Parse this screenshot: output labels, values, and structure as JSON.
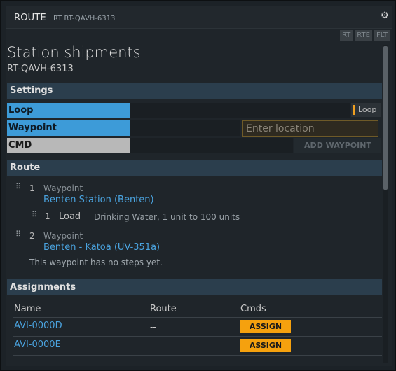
{
  "window": {
    "title": "ROUTE",
    "subtitle": "RT RT-QAVH-6313",
    "settings_icon": "gear-icon"
  },
  "modes": [
    "RT",
    "RTE",
    "FLT"
  ],
  "page": {
    "title": "Station shipments",
    "subtitle": "RT-QAVH-6313"
  },
  "settings": {
    "heading": "Settings",
    "loop_label": "Loop",
    "loop_toggle_text": "Loop",
    "waypoint_label": "Waypoint",
    "location_placeholder": "Enter location",
    "location_value": "",
    "cmd_label": "CMD",
    "add_waypoint_label": "ADD WAYPOINT"
  },
  "route": {
    "heading": "Route",
    "waypoints": [
      {
        "number": "1",
        "type": "Waypoint",
        "location": "Benten Station (Benten)",
        "steps": [
          {
            "number": "1",
            "action": "Load",
            "detail": "Drinking Water, 1 unit to 100 units"
          }
        ]
      },
      {
        "number": "2",
        "type": "Waypoint",
        "location": "Benten - Katoa (UV-351a)",
        "empty_text": "This waypoint has no steps yet."
      }
    ]
  },
  "assignments": {
    "heading": "Assignments",
    "columns": [
      "Name",
      "Route",
      "Cmds"
    ],
    "rows": [
      {
        "name": "AVI-0000D",
        "route": "--",
        "action": "ASSIGN"
      },
      {
        "name": "AVI-0000E",
        "route": "--",
        "action": "ASSIGN"
      }
    ]
  },
  "colors": {
    "accent_blue": "#3d9bd8",
    "link_blue": "#4aa3df",
    "assign_orange": "#f5a10e",
    "section_header": "#2b3e4d"
  }
}
